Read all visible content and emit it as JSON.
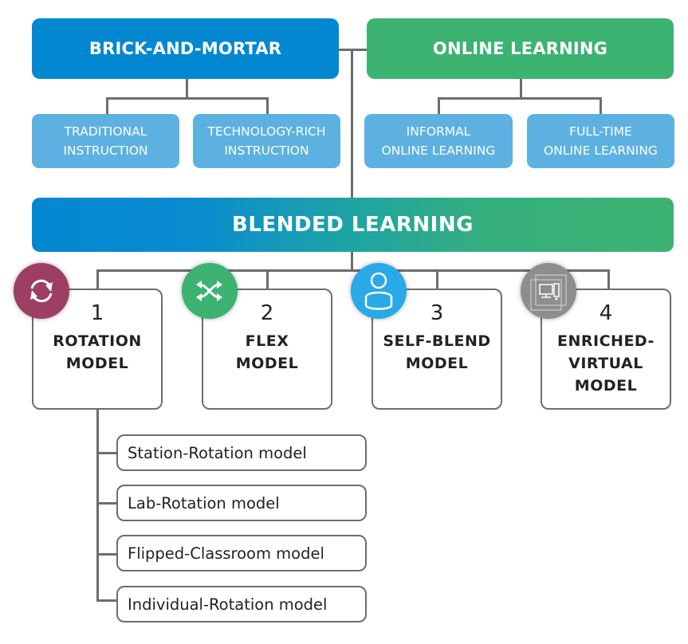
{
  "diagram": {
    "brick_and_mortar": {
      "label": "BRICK-AND-MORTAR",
      "color": "#0288d1",
      "children": [
        "TRADITIONAL\nINSTRUCTION",
        "TECHNOLOGY-RICH\nINSTRUCTION"
      ]
    },
    "online_learning": {
      "label": "ONLINE LEARNING",
      "color": "#3cb371",
      "children": [
        "INFORMAL\nONLINE LEARNING",
        "FULL-TIME\nONLINE LEARNING"
      ]
    },
    "sub_box_color": "#5cb1e0",
    "blended": {
      "label": "BLENDED LEARNING",
      "gradient": [
        "#0288d1",
        "#3cb371"
      ]
    },
    "models": [
      {
        "number": "1",
        "title": "ROTATION\nMODEL",
        "icon": "rotate-arrows-icon",
        "icon_color": "#9c3f62"
      },
      {
        "number": "2",
        "title": "FLEX\nMODEL",
        "icon": "shuffle-icon",
        "icon_color": "#3cb371"
      },
      {
        "number": "3",
        "title": "SELF-BLEND\nMODEL",
        "icon": "person-icon",
        "icon_color": "#29a9e6"
      },
      {
        "number": "4",
        "title": "ENRICHED-\nVIRTUAL\nMODEL",
        "icon": "computer-icon",
        "icon_color": "#8e8e8e"
      }
    ],
    "rotation_submodels": [
      "Station-Rotation model",
      "Lab-Rotation model",
      "Flipped-Classroom model",
      "Individual-Rotation model"
    ]
  }
}
